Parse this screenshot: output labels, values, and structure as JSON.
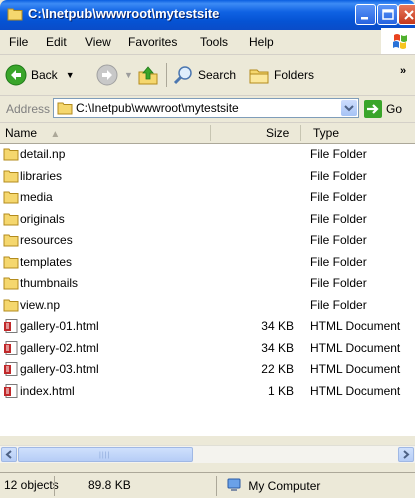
{
  "window": {
    "title": "C:\\Inetpub\\wwwroot\\mytestsite"
  },
  "menu": [
    "File",
    "Edit",
    "View",
    "Favorites",
    "Tools",
    "Help"
  ],
  "toolbar": {
    "back_label": "Back",
    "search_label": "Search",
    "folders_label": "Folders",
    "more": "»"
  },
  "address": {
    "label": "Address",
    "value": "C:\\Inetpub\\wwwroot\\mytestsite",
    "go_label": "Go"
  },
  "columns": {
    "name": "Name",
    "size": "Size",
    "type": "Type"
  },
  "files": [
    {
      "name": "detail.np",
      "size": "",
      "type": "File Folder",
      "kind": "folder"
    },
    {
      "name": "libraries",
      "size": "",
      "type": "File Folder",
      "kind": "folder"
    },
    {
      "name": "media",
      "size": "",
      "type": "File Folder",
      "kind": "folder"
    },
    {
      "name": "originals",
      "size": "",
      "type": "File Folder",
      "kind": "folder"
    },
    {
      "name": "resources",
      "size": "",
      "type": "File Folder",
      "kind": "folder"
    },
    {
      "name": "templates",
      "size": "",
      "type": "File Folder",
      "kind": "folder"
    },
    {
      "name": "thumbnails",
      "size": "",
      "type": "File Folder",
      "kind": "folder"
    },
    {
      "name": "view.np",
      "size": "",
      "type": "File Folder",
      "kind": "folder"
    },
    {
      "name": "gallery-01.html",
      "size": "34 KB",
      "type": "HTML Document",
      "kind": "html"
    },
    {
      "name": "gallery-02.html",
      "size": "34 KB",
      "type": "HTML Document",
      "kind": "html"
    },
    {
      "name": "gallery-03.html",
      "size": "22 KB",
      "type": "HTML Document",
      "kind": "html"
    },
    {
      "name": "index.html",
      "size": "1 KB",
      "type": "HTML Document",
      "kind": "html"
    }
  ],
  "status": {
    "objects": "12 objects",
    "size": "89.8 KB",
    "location": "My Computer"
  },
  "colors": {
    "titlebar": "#0553d4",
    "chrome": "#ece9d8",
    "folder": "#f5d76e",
    "html_icon": "#c0282a"
  }
}
